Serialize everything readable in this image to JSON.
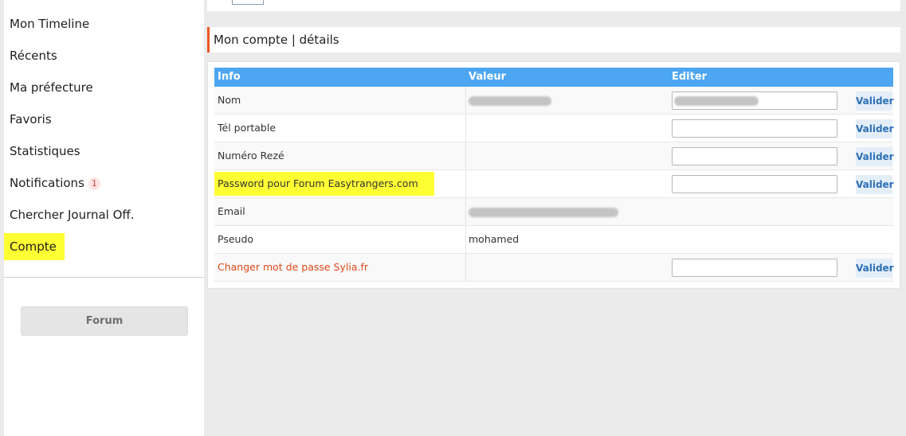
{
  "sidebar": {
    "items": [
      {
        "label": "Mon Timeline"
      },
      {
        "label": "Récents"
      },
      {
        "label": "Ma préfecture"
      },
      {
        "label": "Favoris"
      },
      {
        "label": "Statistiques"
      },
      {
        "label": "Notifications",
        "badge": "1"
      },
      {
        "label": "Chercher Journal Off."
      },
      {
        "label": "Compte"
      }
    ],
    "forum_button": "Forum"
  },
  "main": {
    "title": "Mon compte | détails",
    "table": {
      "headers": [
        "Info",
        "Valeur",
        "Editer"
      ],
      "rows": [
        {
          "label": "Nom",
          "value": "",
          "button": "Valider"
        },
        {
          "label": "Tél portable",
          "value": "",
          "button": "Valider"
        },
        {
          "label": "Numéro Rezé",
          "value": "",
          "button": "Valider"
        },
        {
          "label": "Password pour Forum Easytrangers.com",
          "value": "",
          "button": "Valider"
        },
        {
          "label": "Email",
          "value": ""
        },
        {
          "label": "Pseudo",
          "value": "mohamed"
        },
        {
          "label": "Changer mot de passe Sylia.fr",
          "value": "",
          "button": "Valider"
        }
      ]
    }
  },
  "colors": {
    "accent": "#ee5522",
    "table_header": "#4da6f2",
    "highlight": "#ffff33",
    "link_red": "#e04a1a",
    "valider_text": "#2c6fb5"
  }
}
